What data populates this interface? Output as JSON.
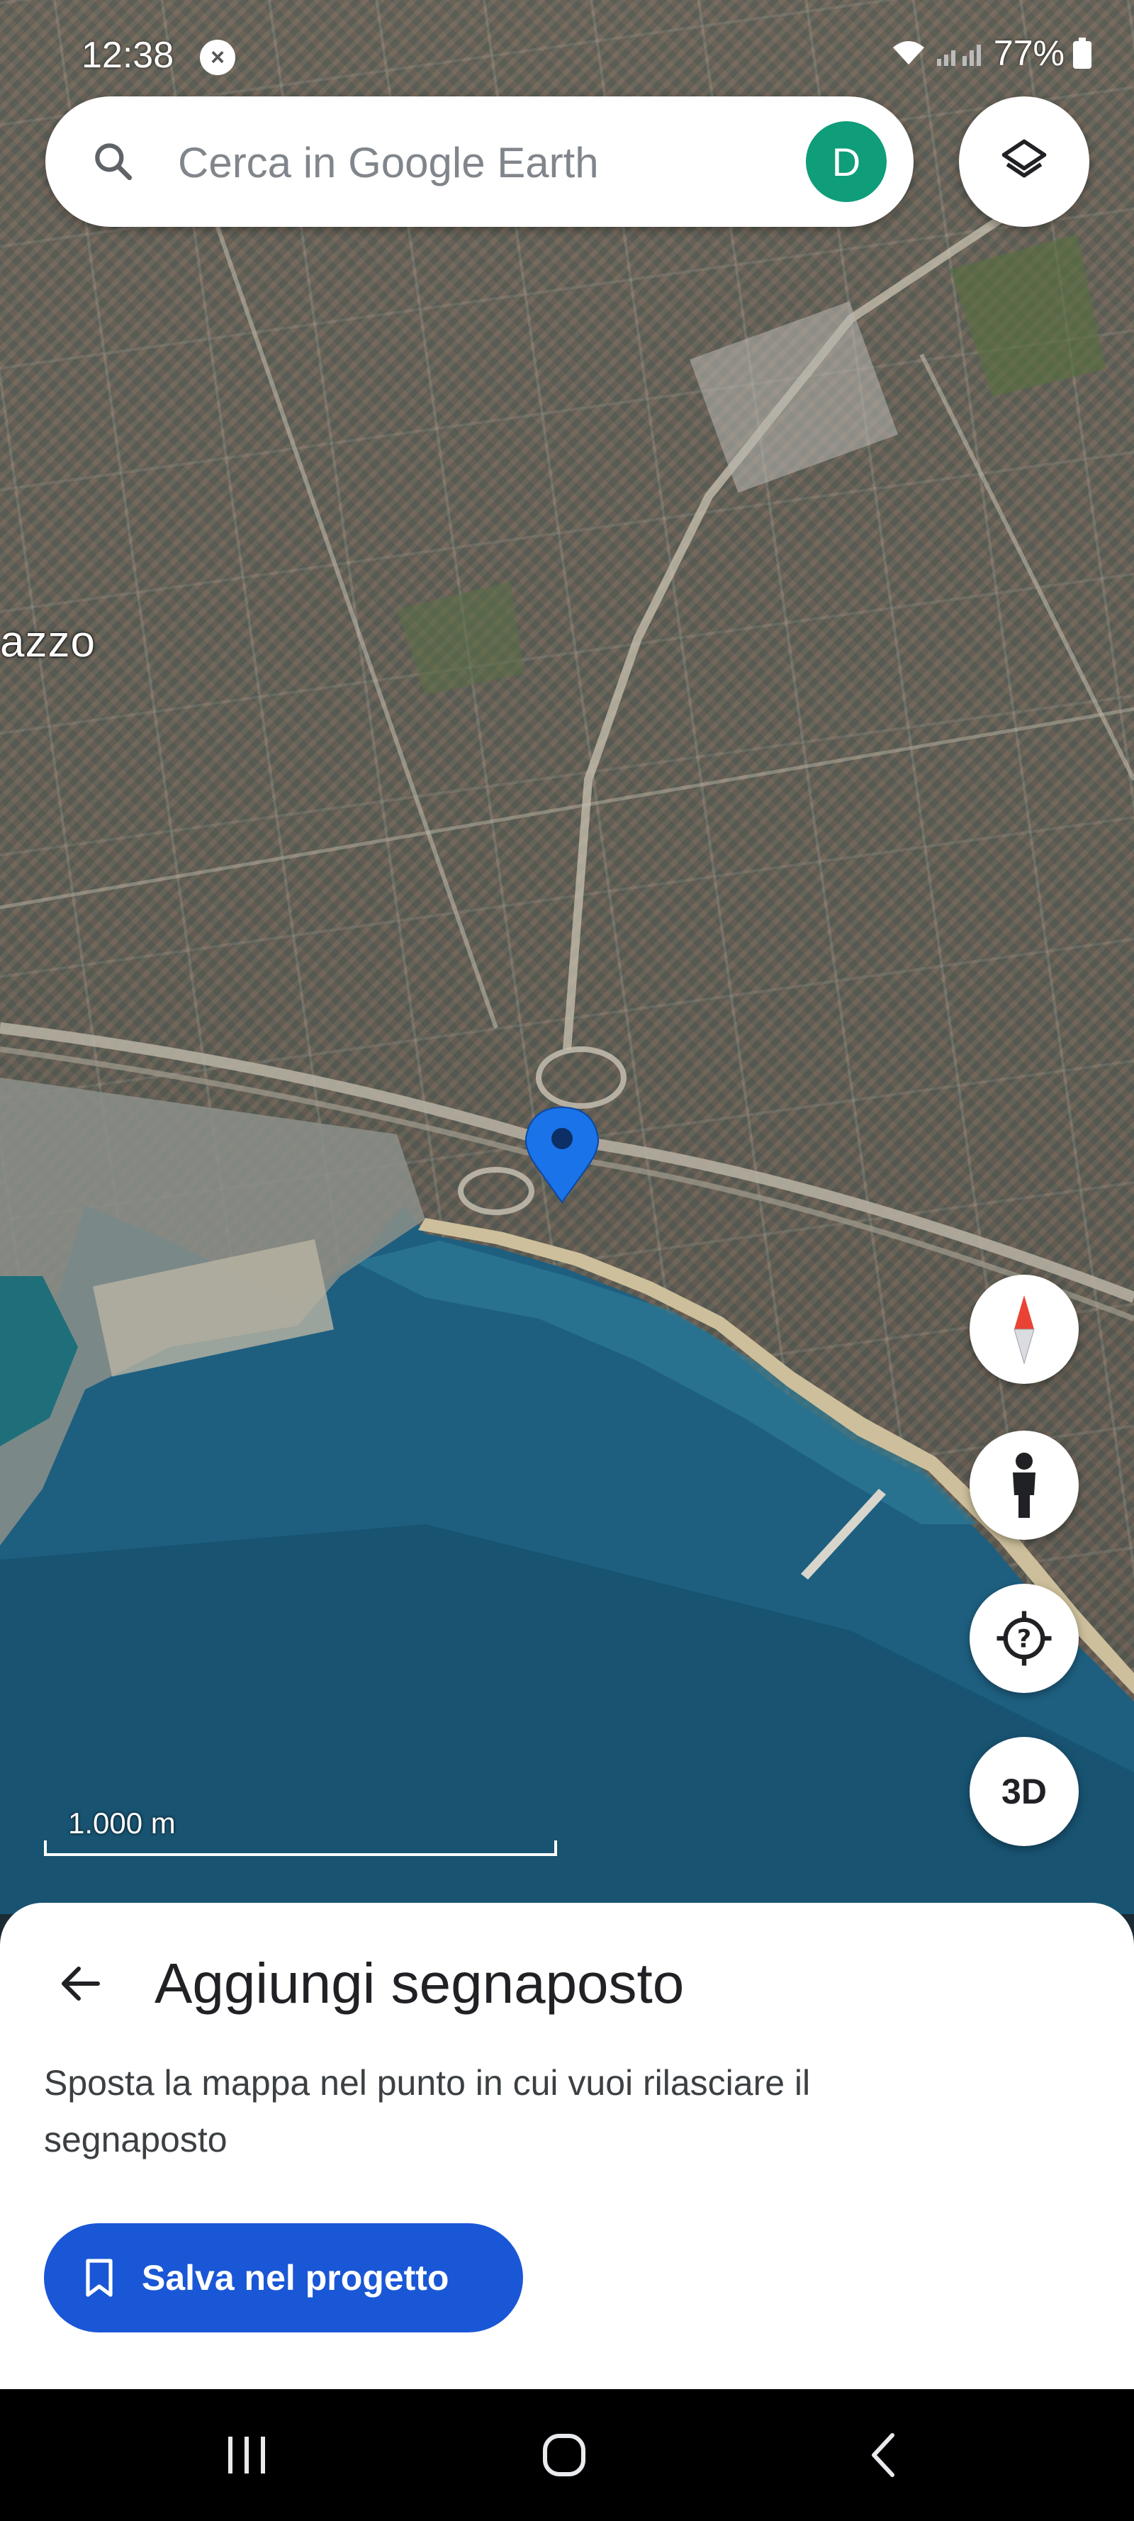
{
  "status_bar": {
    "time": "12:38",
    "notification_icon": "chat-bubble-icon",
    "battery": "77%",
    "icons": [
      "wifi-icon",
      "signal-icon",
      "battery-icon"
    ]
  },
  "search": {
    "placeholder": "Cerca in Google Earth",
    "avatar_letter": "D",
    "avatar_color": "#0f9d7a"
  },
  "map": {
    "place_label": "azzo",
    "scale_label": "1.000 m",
    "pin_color": "#1a73e8",
    "sea_color": "#1e5f80"
  },
  "controls": {
    "compass": "compass-icon",
    "street_view": "pegman-icon",
    "my_location": "location-help-icon",
    "view_3d": "3D",
    "layers": "layers-icon"
  },
  "sheet": {
    "title": "Aggiungi segnaposto",
    "description": "Sposta la mappa nel punto in cui vuoi rilasciare il segnaposto",
    "save_label": "Salva nel progetto",
    "save_color": "#1a57d6"
  },
  "navbar": {
    "items": [
      "recent-apps-icon",
      "home-icon",
      "back-icon"
    ]
  }
}
